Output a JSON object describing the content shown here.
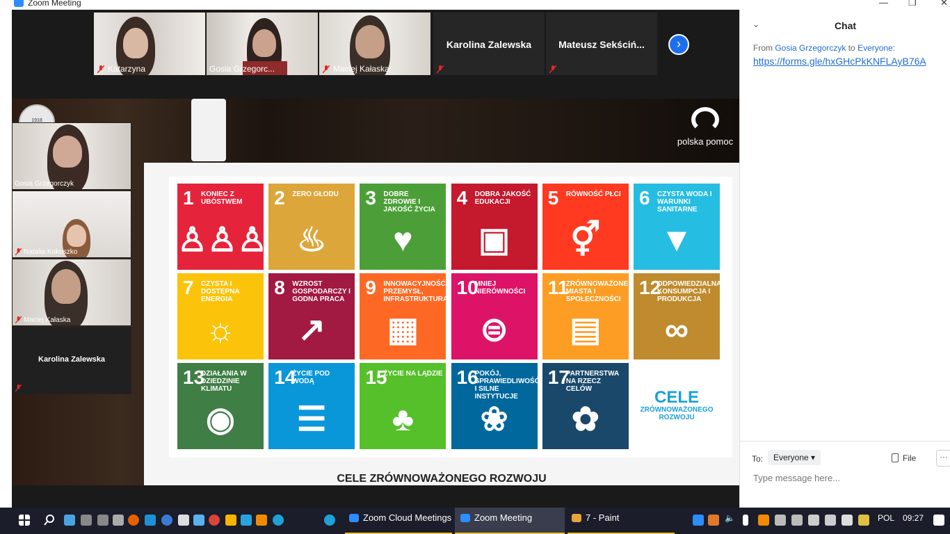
{
  "window": {
    "title": "Zoom Meeting"
  },
  "gallery": {
    "participants": [
      {
        "name": "Katarzyna",
        "muted": true
      },
      {
        "name": "Gosia Grzegorc...",
        "muted": false,
        "active_speaker": true
      },
      {
        "name": "Maciej Kałaska",
        "muted": true
      },
      {
        "name": "Karolina Zalewska",
        "muted": true,
        "video_off": true
      },
      {
        "name": "Mateusz  Sekściń...",
        "muted": true,
        "video_off": true
      }
    ]
  },
  "side_videos": [
    {
      "name": "Gosia Grzegorczyk",
      "muted": false
    },
    {
      "name": "Natalia Kokoszko",
      "muted": true
    },
    {
      "name": "Maciej Kałaska",
      "muted": true
    },
    {
      "name": "Karolina Zalewska",
      "muted": true,
      "video_off": true
    }
  ],
  "shared_screen": {
    "logo_text": "polska pomoc",
    "caption": "CELE ZRÓWNOWAŻONEGO ROZWOJU",
    "goals": [
      {
        "n": "1",
        "label": "KONIEC Z UBÓSTWEM",
        "color": "#e5243b",
        "icon": "people-icon"
      },
      {
        "n": "2",
        "label": "ZERO GŁODU",
        "color": "#dda63a",
        "icon": "bowl-icon"
      },
      {
        "n": "3",
        "label": "DOBRE ZDROWIE I JAKOŚĆ ŻYCIA",
        "color": "#4c9f38",
        "icon": "heartbeat-icon"
      },
      {
        "n": "4",
        "label": "DOBRA JAKOŚĆ EDUKACJI",
        "color": "#c5192d",
        "icon": "book-icon"
      },
      {
        "n": "5",
        "label": "RÓWNOŚĆ PŁCI",
        "color": "#ff3a21",
        "icon": "gender-icon"
      },
      {
        "n": "6",
        "label": "CZYSTA WODA I WARUNKI SANITARNE",
        "color": "#26bde2",
        "icon": "water-icon"
      },
      {
        "n": "7",
        "label": "CZYSTA I DOSTĘPNA ENERGIA",
        "color": "#fcc30b",
        "icon": "sun-icon"
      },
      {
        "n": "8",
        "label": "WZROST GOSPODARCZY I GODNA PRACA",
        "color": "#a21942",
        "icon": "growth-icon"
      },
      {
        "n": "9",
        "label": "INNOWACYJNOŚĆ, PRZEMYSŁ, INFRASTRUKTURA",
        "color": "#fd6925",
        "icon": "cubes-icon"
      },
      {
        "n": "10",
        "label": "MNIEJ NIERÓWNOŚCI",
        "color": "#dd1367",
        "icon": "equal-icon"
      },
      {
        "n": "11",
        "label": "ZRÓWNOWAŻONE MIASTA I SPOŁECZNOŚCI",
        "color": "#fd9d24",
        "icon": "city-icon"
      },
      {
        "n": "12",
        "label": "ODPOWIEDZIALNA KONSUMPCJA I PRODUKCJA",
        "color": "#bf8b2e",
        "icon": "infinity-icon"
      },
      {
        "n": "13",
        "label": "DZIAŁANIA W DZIEDZINIE KLIMATU",
        "color": "#3f7e44",
        "icon": "eye-globe-icon"
      },
      {
        "n": "14",
        "label": "ŻYCIE POD WODĄ",
        "color": "#0a97d9",
        "icon": "fish-icon"
      },
      {
        "n": "15",
        "label": "ŻYCIE NA LĄDZIE",
        "color": "#56c02b",
        "icon": "tree-icon"
      },
      {
        "n": "16",
        "label": "POKÓJ, SPRAWIEDLIWOŚĆ I SILNE INSTYTUCJE",
        "color": "#00689d",
        "icon": "dove-icon"
      },
      {
        "n": "17",
        "label": "PARTNERSTWA NA RZECZ CELÓW",
        "color": "#19486a",
        "icon": "flower-icon"
      }
    ],
    "celeo_title": "CELE",
    "celeo_sub1": "ZRÓWNOWAŻONEGO",
    "celeo_sub2": "ROZWOJU"
  },
  "chat": {
    "title": "Chat",
    "from_label": "From",
    "sender": "Gosia Grzegorczyk",
    "to_label": "to",
    "recipient": "Everyone:",
    "link": "https://forms.gle/hxGHcPkKNFLAyB76A",
    "to_prefix": "To:",
    "to_value": "Everyone",
    "file_label": "File",
    "more_label": "···",
    "input_placeholder": "Type message here..."
  },
  "taskbar": {
    "buttons": [
      {
        "label": "Zoom Cloud Meetings"
      },
      {
        "label": "Zoom Meeting"
      },
      {
        "label": "7 - Paint"
      }
    ],
    "language": "POL",
    "time": "09:27"
  }
}
